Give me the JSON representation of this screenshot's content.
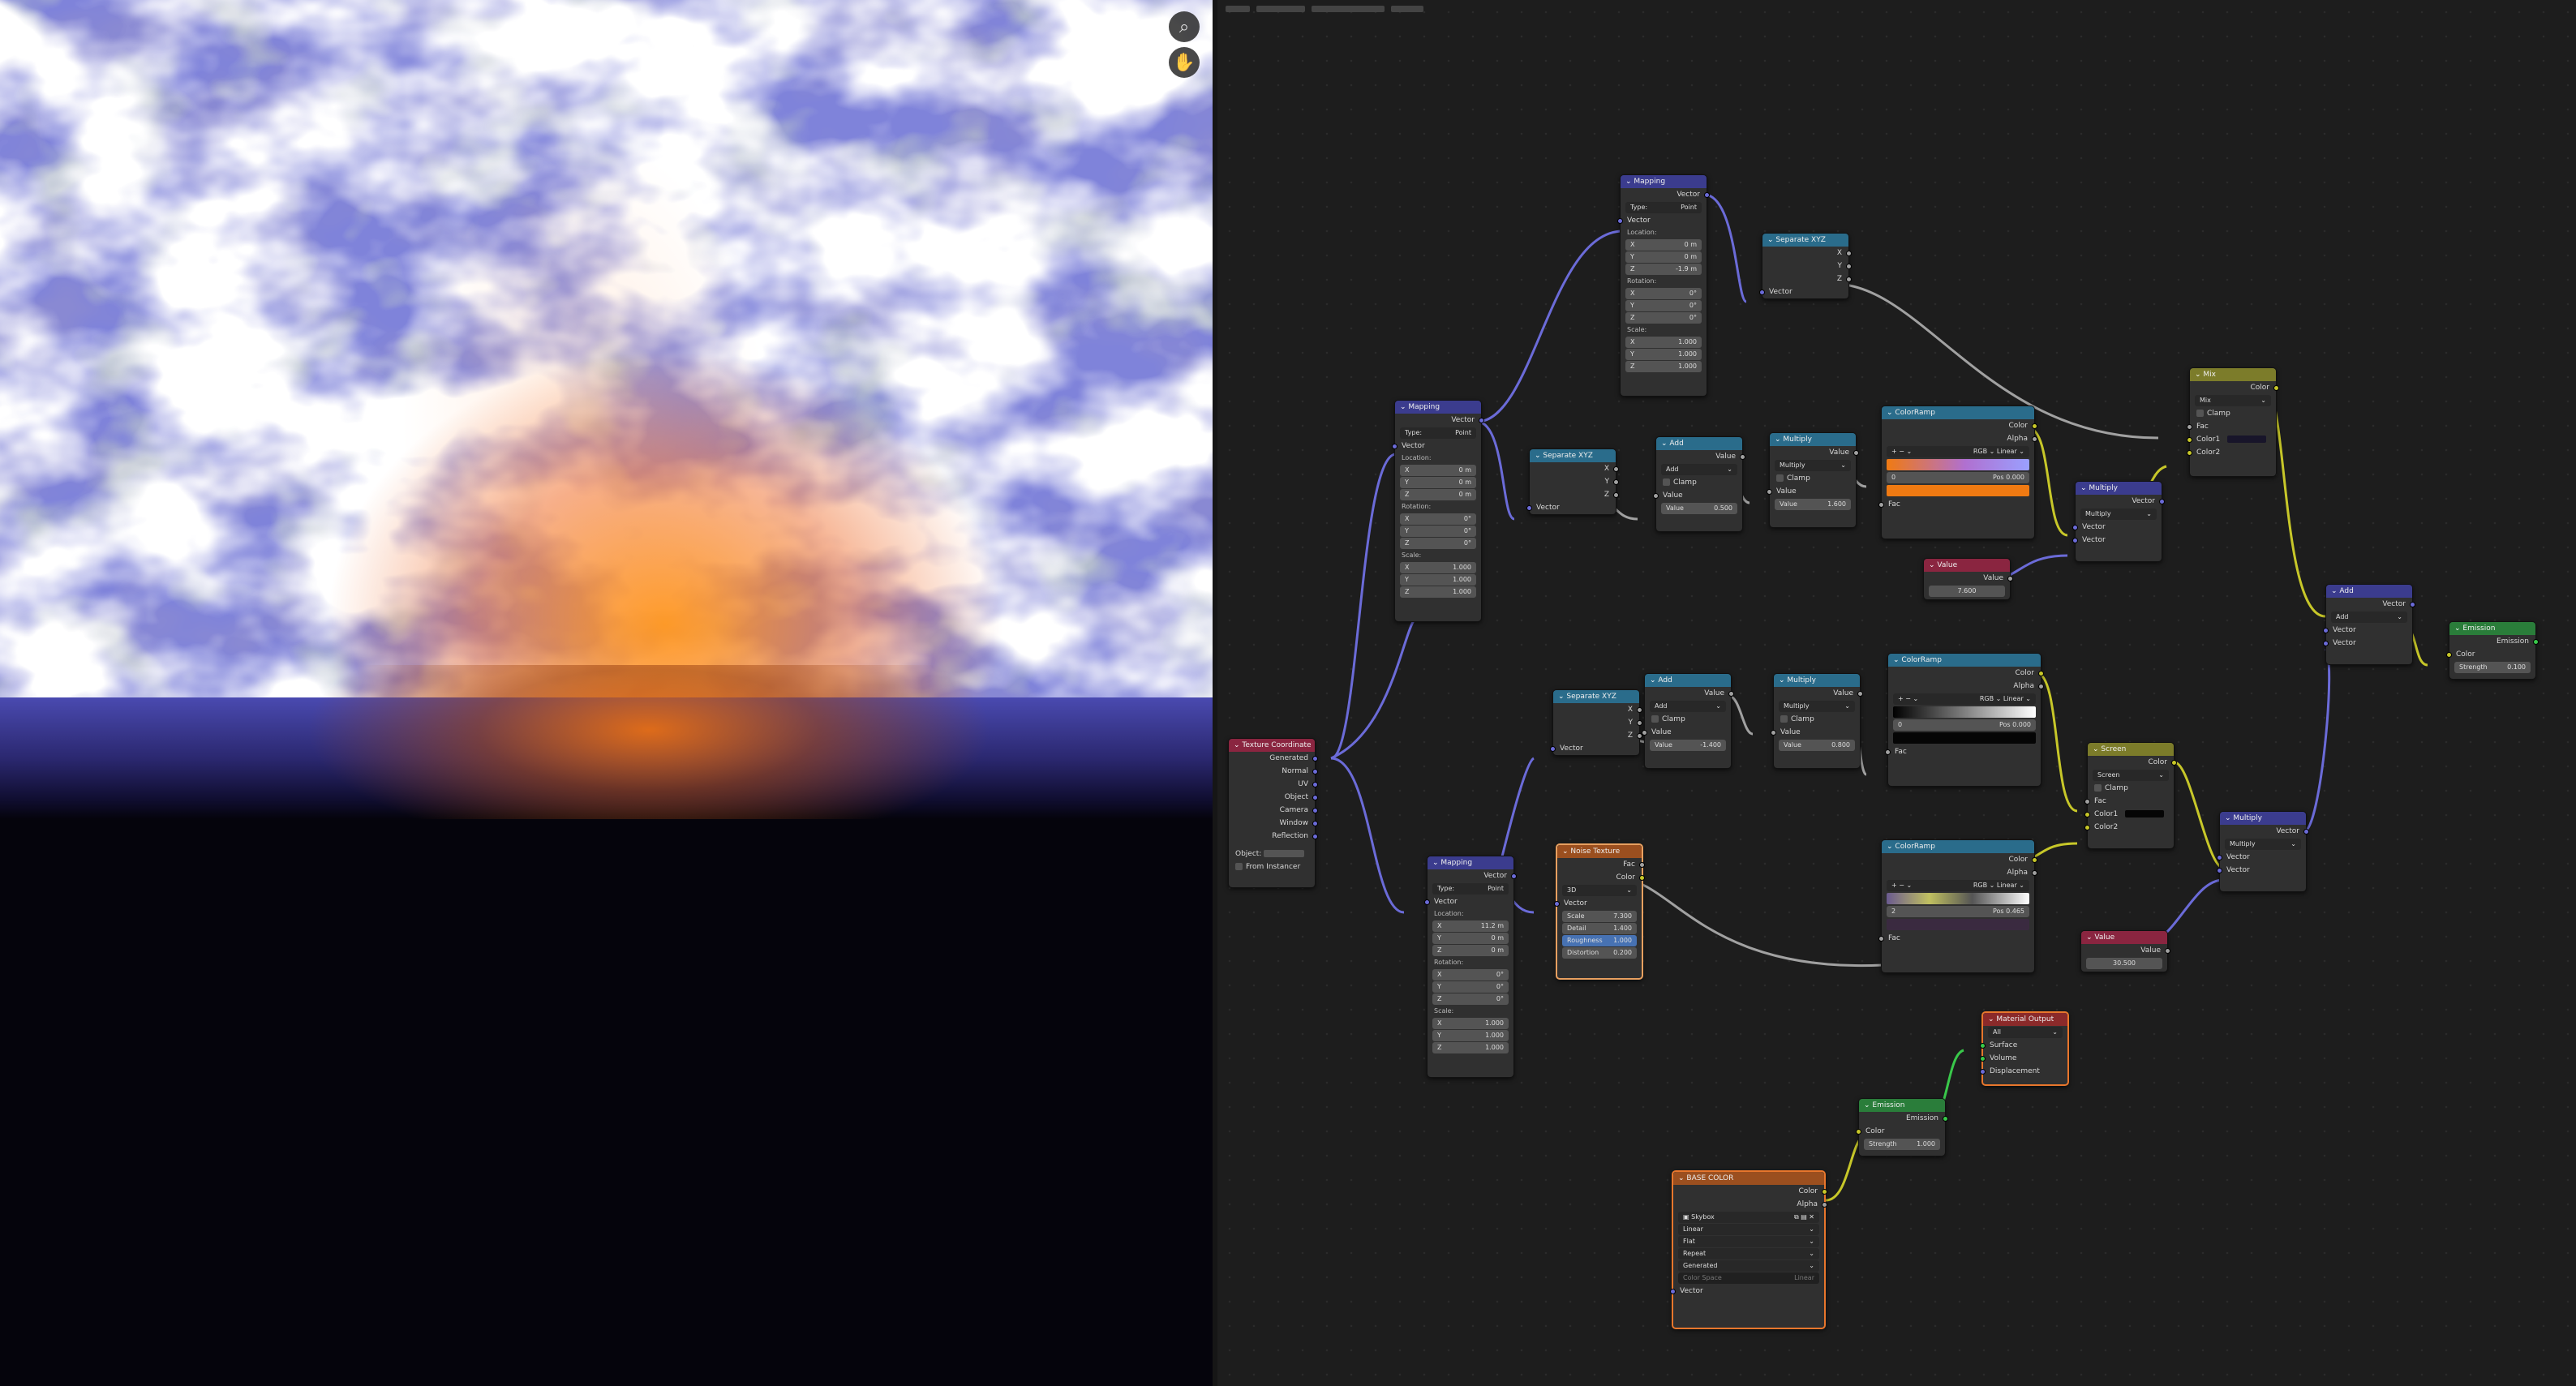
{
  "viewport": {
    "icons": [
      {
        "name": "zoom-icon",
        "glyph": "⌕"
      },
      {
        "name": "pan-hand-icon",
        "glyph": "✋"
      }
    ],
    "colors": {
      "sky": "#8e92e4",
      "glow": "#ff9a20",
      "ground": "#05040c"
    }
  },
  "editor": {
    "background": "#1d1d1d"
  },
  "mapping_top": {
    "title": "Mapping",
    "out": "Vector",
    "type_label": "Type:",
    "type": "Point",
    "vector": "Vector",
    "loc": "Location:",
    "lx": "0 m",
    "ly": "0 m",
    "lz": "-1.9 m",
    "rot": "Rotation:",
    "rx": "0°",
    "ry": "0°",
    "rz": "0°",
    "scale": "Scale:",
    "sx": "1.000",
    "sy": "1.000",
    "sz": "1.000"
  },
  "mapping_mid": {
    "title": "Mapping",
    "out": "Vector",
    "type_label": "Type:",
    "type": "Point",
    "vector": "Vector",
    "loc": "Location:",
    "lx": "0 m",
    "ly": "0 m",
    "lz": "0 m",
    "rot": "Rotation:",
    "rx": "0°",
    "ry": "0°",
    "rz": "0°",
    "scale": "Scale:",
    "sx": "1.000",
    "sy": "1.000",
    "sz": "1.000"
  },
  "mapping_low": {
    "title": "Mapping",
    "out": "Vector",
    "type_label": "Type:",
    "type": "Point",
    "vector": "Vector",
    "loc": "Location:",
    "lx": "11.2 m",
    "ly": "0 m",
    "lz": "0 m",
    "rot": "Rotation:",
    "rx": "0°",
    "ry": "0°",
    "rz": "0°",
    "scale": "Scale:",
    "sx": "1.000",
    "sy": "1.000",
    "sz": "1.000"
  },
  "sep1": {
    "title": "Separate XYZ",
    "x": "X",
    "y": "Y",
    "z": "Z",
    "vec": "Vector"
  },
  "sep2": {
    "title": "Separate XYZ",
    "x": "X",
    "y": "Y",
    "z": "Z",
    "vec": "Vector"
  },
  "sep3": {
    "title": "Separate XYZ",
    "x": "X",
    "y": "Y",
    "z": "Z",
    "vec": "Vector"
  },
  "add1": {
    "title": "Add",
    "out": "Value",
    "op": "Add",
    "clamp": "Clamp",
    "v1": "Value",
    "v2": "Value",
    "v2val": "0.500"
  },
  "mul1": {
    "title": "Multiply",
    "out": "Value",
    "op": "Multiply",
    "clamp": "Clamp",
    "v1": "Value",
    "v2": "Value",
    "v2val": "1.600"
  },
  "add2": {
    "title": "Add",
    "out": "Value",
    "op": "Add",
    "clamp": "Clamp",
    "v1": "Value",
    "v2": "Value",
    "v2val": "-1.400"
  },
  "mul2": {
    "title": "Multiply",
    "out": "Value",
    "op": "Multiply",
    "clamp": "Clamp",
    "v1": "Value",
    "v2": "Value",
    "v2val": "0.800"
  },
  "cr1": {
    "title": "ColorRamp",
    "color": "Color",
    "alpha": "Alpha",
    "mode": "RGB",
    "interp": "Linear",
    "idx": "0",
    "pos": "Pos",
    "posval": "0.000",
    "fac": "Fac",
    "swatch": "#f07a12"
  },
  "cr2": {
    "title": "ColorRamp",
    "color": "Color",
    "alpha": "Alpha",
    "mode": "RGB",
    "interp": "Linear",
    "idx": "0",
    "pos": "Pos",
    "posval": "0.000",
    "fac": "Fac",
    "swatch": "#050505"
  },
  "cr3": {
    "title": "ColorRamp",
    "color": "Color",
    "alpha": "Alpha",
    "mode": "RGB",
    "interp": "Linear",
    "idx": "2",
    "pos": "Pos",
    "posval": "0.465",
    "fac": "Fac",
    "swatch": "#3a2a40"
  },
  "value1": {
    "title": "Value",
    "out": "Value",
    "val": "7.600"
  },
  "value2": {
    "title": "Value",
    "out": "Value",
    "val": "30.500"
  },
  "mul_top": {
    "title": "Multiply",
    "out": "Vector",
    "op": "Multiply",
    "v1": "Vector",
    "v2": "Vector"
  },
  "mul_low": {
    "title": "Multiply",
    "out": "Vector",
    "op": "Multiply",
    "v1": "Vector",
    "v2": "Vector"
  },
  "mix": {
    "title": "Mix",
    "out": "Color",
    "op": "Mix",
    "clamp": "Clamp",
    "fac": "Fac",
    "c1": "Color1",
    "c2": "Color2"
  },
  "screen": {
    "title": "Screen",
    "out": "Color",
    "op": "Screen",
    "clamp": "Clamp",
    "fac": "Fac",
    "c1": "Color1",
    "c2": "Color2"
  },
  "add_vec": {
    "title": "Add",
    "out": "Vector",
    "op": "Add",
    "v1": "Vector",
    "v2": "Vector"
  },
  "emission_r": {
    "title": "Emission",
    "out": "Emission",
    "color": "Color",
    "strength": "Strength",
    "sval": "0.100"
  },
  "emission_b": {
    "title": "Emission",
    "out": "Emission",
    "color": "Color",
    "strength": "Strength",
    "sval": "1.000"
  },
  "texcoord": {
    "title": "Texture Coordinate",
    "outs": [
      "Generated",
      "Normal",
      "UV",
      "Object",
      "Camera",
      "Window",
      "Reflection"
    ],
    "object": "Object:",
    "instancer": "From Instancer"
  },
  "noise": {
    "title": "Noise Texture",
    "fac": "Fac",
    "color": "Color",
    "dim": "3D",
    "vector": "Vector",
    "scale": "Scale",
    "scaleval": "7.300",
    "detail": "Detail",
    "detailval": "1.400",
    "rough": "Roughness",
    "roughval": "1.000",
    "dist": "Distortion",
    "distval": "0.200"
  },
  "matout": {
    "title": "Material Output",
    "target": "All",
    "surface": "Surface",
    "volume": "Volume",
    "disp": "Displacement"
  },
  "basecolor": {
    "title": "BASE COLOR",
    "color": "Color",
    "alpha": "Alpha",
    "image": "Skybox",
    "interp": "Linear",
    "proj": "Flat",
    "ext": "Repeat",
    "src": "Generated",
    "cs": "Color Space",
    "csval": "Linear",
    "vector": "Vector"
  }
}
